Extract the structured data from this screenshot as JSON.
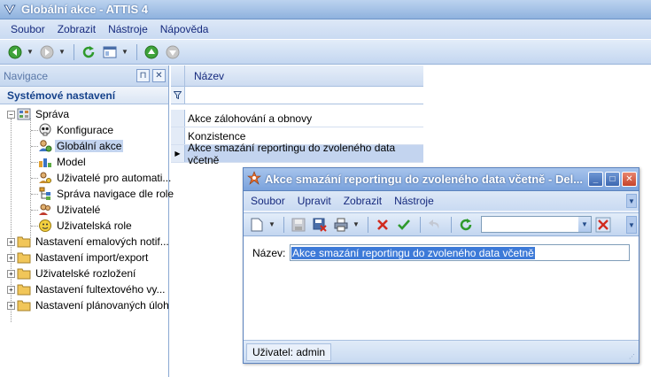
{
  "window": {
    "title": "Globální akce - ATTIS 4"
  },
  "menu": [
    "Soubor",
    "Zobrazit",
    "Nástroje",
    "Nápověda"
  ],
  "nav": {
    "header": "Navigace",
    "section": "Systémové nastavení",
    "tree": [
      {
        "label": "Správa",
        "expanded": true,
        "level": 0
      },
      {
        "label": "Konfigurace",
        "level": 1
      },
      {
        "label": "Globální akce",
        "level": 1,
        "selected": true
      },
      {
        "label": "Model",
        "level": 1
      },
      {
        "label": "Uživatelé pro automati...",
        "level": 1
      },
      {
        "label": "Správa navigace dle role",
        "level": 1
      },
      {
        "label": "Uživatelé",
        "level": 1
      },
      {
        "label": "Uživatelská role",
        "level": 1
      },
      {
        "label": "Nastavení emalových notif...",
        "level": 0
      },
      {
        "label": "Nastavení import/export",
        "level": 0
      },
      {
        "label": "Uživatelské rozložení",
        "level": 0
      },
      {
        "label": "Nastavení fultextového vy...",
        "level": 0
      },
      {
        "label": "Nastavení plánovaných úloh",
        "level": 0
      }
    ]
  },
  "grid": {
    "column": "Název",
    "rows": [
      "Akce zálohování a obnovy",
      "Konzistence",
      "Akce smazání reportingu do zvoleného data včetně"
    ],
    "selected_row": 2
  },
  "dialog": {
    "title": "Akce smazání reportingu do zvoleného data včetně - Del...",
    "menu": [
      "Soubor",
      "Upravit",
      "Zobrazit",
      "Nástroje"
    ],
    "field_label": "Název:",
    "field_value": "Akce smazání reportingu do zvoleného data včetně",
    "status": "Uživatel: admin"
  },
  "colors": {
    "selection": "#c3d4ef",
    "title_accent": "#8fb2de",
    "input_selection": "#3d7ad8"
  }
}
